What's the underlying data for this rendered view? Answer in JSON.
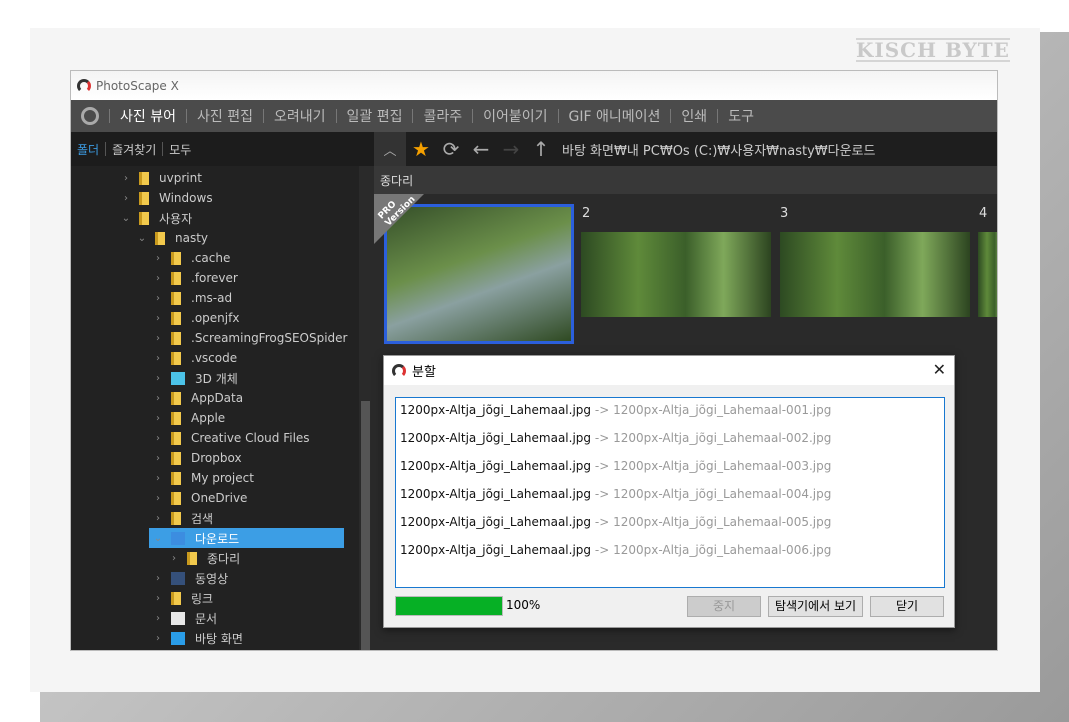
{
  "watermark": "KISCH BYTE",
  "app": {
    "title": "PhotoScape X"
  },
  "menu": [
    "사진 뷰어",
    "사진 편집",
    "오려내기",
    "일괄 편집",
    "콜라주",
    "이어붙이기",
    "GIF 애니메이션",
    "인쇄",
    "도구"
  ],
  "sidebar": {
    "tabs": [
      "폴더",
      "즐겨찾기",
      "모두"
    ],
    "tree": [
      {
        "label": "uvprint",
        "level": 0,
        "icon": "folder"
      },
      {
        "label": "Windows",
        "level": 0,
        "icon": "folder"
      },
      {
        "label": "사용자",
        "level": 0,
        "icon": "folder",
        "expanded": true
      },
      {
        "label": "nasty",
        "level": 1,
        "icon": "folder",
        "expanded": true
      },
      {
        "label": ".cache",
        "level": 2,
        "icon": "folder"
      },
      {
        "label": ".forever",
        "level": 2,
        "icon": "folder"
      },
      {
        "label": ".ms-ad",
        "level": 2,
        "icon": "folder"
      },
      {
        "label": ".openjfx",
        "level": 2,
        "icon": "folder"
      },
      {
        "label": ".ScreamingFrogSEOSpider",
        "level": 2,
        "icon": "folder"
      },
      {
        "label": ".vscode",
        "level": 2,
        "icon": "folder"
      },
      {
        "label": "3D 개체",
        "level": 2,
        "icon": "3d-objects"
      },
      {
        "label": "AppData",
        "level": 2,
        "icon": "folder"
      },
      {
        "label": "Apple",
        "level": 2,
        "icon": "folder"
      },
      {
        "label": "Creative Cloud Files",
        "level": 2,
        "icon": "creative-cloud-folder"
      },
      {
        "label": "Dropbox",
        "level": 2,
        "icon": "dropbox-folder"
      },
      {
        "label": "My project",
        "level": 2,
        "icon": "folder"
      },
      {
        "label": "OneDrive",
        "level": 2,
        "icon": "onedrive-folder"
      },
      {
        "label": "검색",
        "level": 2,
        "icon": "search-folder"
      },
      {
        "label": "다운로드",
        "level": 2,
        "icon": "download",
        "selected": true,
        "expanded": true
      },
      {
        "label": "종다리",
        "level": 3,
        "icon": "folder"
      },
      {
        "label": "동영상",
        "level": 2,
        "icon": "videos"
      },
      {
        "label": "링크",
        "level": 2,
        "icon": "links"
      },
      {
        "label": "문서",
        "level": 2,
        "icon": "documents"
      },
      {
        "label": "바탕 화면",
        "level": 2,
        "icon": "desktop"
      }
    ]
  },
  "toolbar": {
    "path": "바탕 화면₩내 PC₩Os (C:)₩사용자₩nasty₩다운로드",
    "star_color": "#f5a000"
  },
  "folder_name": "종다리",
  "thumbnails": {
    "badge": "PRO Version",
    "numbers": [
      "2",
      "3",
      "4"
    ]
  },
  "dialog": {
    "title": "분할",
    "items": [
      {
        "src": "1200px-Altja_jõgi_Lahemaal.jpg",
        "arrow": "->",
        "dst": "1200px-Altja_jõgi_Lahemaal-001.jpg"
      },
      {
        "src": "1200px-Altja_jõgi_Lahemaal.jpg",
        "arrow": "->",
        "dst": "1200px-Altja_jõgi_Lahemaal-002.jpg"
      },
      {
        "src": "1200px-Altja_jõgi_Lahemaal.jpg",
        "arrow": "->",
        "dst": "1200px-Altja_jõgi_Lahemaal-003.jpg"
      },
      {
        "src": "1200px-Altja_jõgi_Lahemaal.jpg",
        "arrow": "->",
        "dst": "1200px-Altja_jõgi_Lahemaal-004.jpg"
      },
      {
        "src": "1200px-Altja_jõgi_Lahemaal.jpg",
        "arrow": "->",
        "dst": "1200px-Altja_jõgi_Lahemaal-005.jpg"
      },
      {
        "src": "1200px-Altja_jõgi_Lahemaal.jpg",
        "arrow": "->",
        "dst": "1200px-Altja_jõgi_Lahemaal-006.jpg"
      }
    ],
    "progress": 100,
    "progress_label": "100%",
    "progress_color": "#06b025",
    "stop": "중지",
    "explorer": "탐색기에서 보기",
    "close": "닫기"
  }
}
